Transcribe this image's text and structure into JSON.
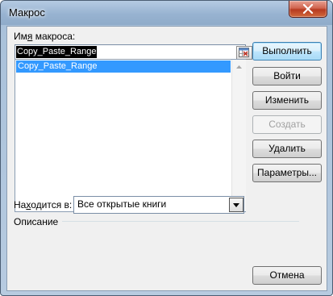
{
  "window": {
    "title": "Макрос"
  },
  "icons": {
    "close": "close-icon",
    "picker": "range-picker-icon",
    "dropdown": "chevron-down-icon"
  },
  "macro_name": {
    "label_pre": "Им",
    "label_mnemonic": "я",
    "label_post": " макроса:",
    "value": "Copy_Paste_Range"
  },
  "macro_list": {
    "items": [
      "Copy_Paste_Range"
    ],
    "selected_index": 0
  },
  "buttons": {
    "run": "Выполнить",
    "step_into": "Войти",
    "edit": "Изменить",
    "create": "Создать",
    "delete": "Удалить",
    "options": "Параметры...",
    "cancel": "Отмена"
  },
  "location": {
    "label_pre": "На",
    "label_mnemonic": "х",
    "label_post": "одится в:",
    "value": "Все открытые книги"
  },
  "description": {
    "label": "Описание"
  }
}
